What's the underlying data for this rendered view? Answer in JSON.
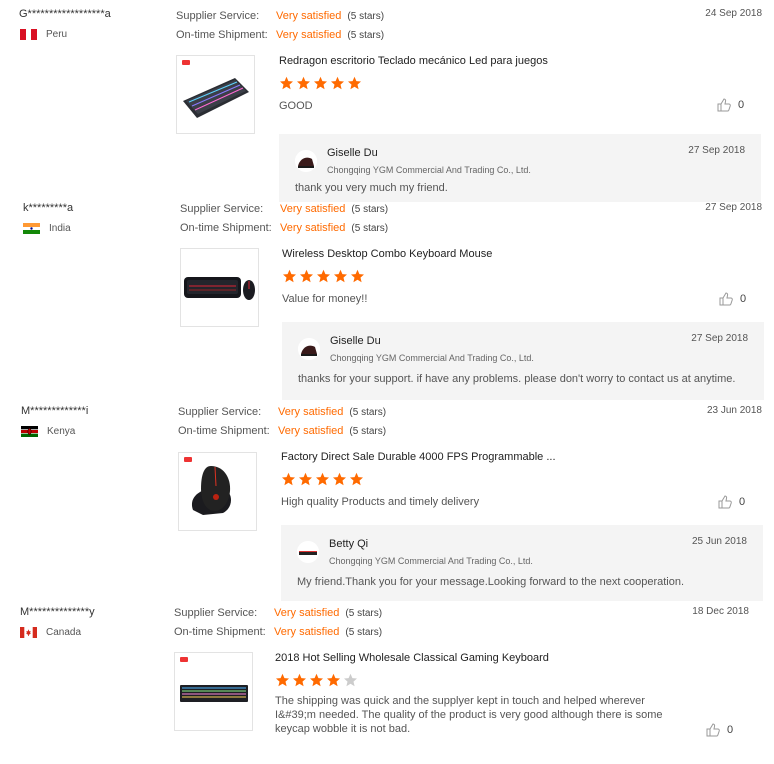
{
  "colors": {
    "accent": "#ff6a00",
    "star_empty": "#cccccc",
    "reply_bg": "#f4f4f4"
  },
  "reviews": [
    {
      "user": "G******************a",
      "country": "Peru",
      "flag": "flag-peru-icon",
      "date": "24 Sep 2018",
      "supplier_service": {
        "label": "Supplier Service:",
        "value": "Very satisfied",
        "stars": "(5 stars)"
      },
      "ontime_shipment": {
        "label": "On-time Shipment:",
        "value": "Very satisfied",
        "stars": "(5 stars)"
      },
      "product_title": "Redragon escritorio Teclado mecánico Led para juegos",
      "product_image": "rgb-mechanical-keyboard",
      "rating": 5,
      "comment": "GOOD",
      "helpful_count": "0",
      "reply": {
        "name": "Giselle Du",
        "company": "Chongqing YGM Commercial And Trading Co., Ltd.",
        "date": "27 Sep 2018",
        "text": "thank you very much my friend."
      }
    },
    {
      "user": "k*********a",
      "country": "India",
      "flag": "flag-india-icon",
      "date": "27 Sep 2018",
      "supplier_service": {
        "label": "Supplier Service:",
        "value": "Very satisfied",
        "stars": "(5 stars)"
      },
      "ontime_shipment": {
        "label": "On-time Shipment:",
        "value": "Very satisfied",
        "stars": "(5 stars)"
      },
      "product_title": "Wireless Desktop Combo Keyboard Mouse",
      "product_image": "keyboard-mouse-combo",
      "rating": 5,
      "comment": "Value for money!!",
      "helpful_count": "0",
      "reply": {
        "name": "Giselle Du",
        "company": "Chongqing YGM Commercial And Trading Co., Ltd.",
        "date": "27 Sep 2018",
        "text": "thanks for your support. if have any problems. please don't worry to contact us at anytime."
      }
    },
    {
      "user": "M*************i",
      "country": "Kenya",
      "flag": "flag-kenya-icon",
      "date": "23 Jun 2018",
      "supplier_service": {
        "label": "Supplier Service:",
        "value": "Very satisfied",
        "stars": "(5 stars)"
      },
      "ontime_shipment": {
        "label": "On-time Shipment:",
        "value": "Very satisfied",
        "stars": "(5 stars)"
      },
      "product_title": "Factory Direct Sale Durable 4000 FPS Programmable ...",
      "product_image": "gaming-mouse",
      "rating": 5,
      "comment": "High quality Products and timely delivery",
      "helpful_count": "0",
      "reply": {
        "name": "Betty Qi",
        "company": "Chongqing YGM Commercial And Trading Co., Ltd.",
        "date": "25 Jun 2018",
        "text": "My friend.Thank you for your message.Looking forward to the next cooperation."
      }
    },
    {
      "user": "M**************y",
      "country": "Canada",
      "flag": "flag-canada-icon",
      "date": "18 Dec 2018",
      "supplier_service": {
        "label": "Supplier Service:",
        "value": "Very satisfied",
        "stars": "(5 stars)"
      },
      "ontime_shipment": {
        "label": "On-time Shipment:",
        "value": "Very satisfied",
        "stars": "(5 stars)"
      },
      "product_title": "2018 Hot Selling Wholesale Classical Gaming Keyboard",
      "product_image": "rgb-gaming-keyboard",
      "rating": 4,
      "comment": "The shipping was quick and the supplyer kept in touch and helped wherever I&#39;m needed. The quality of the product is very good although there is some keycap wobble it is not bad.",
      "helpful_count": "0"
    }
  ]
}
